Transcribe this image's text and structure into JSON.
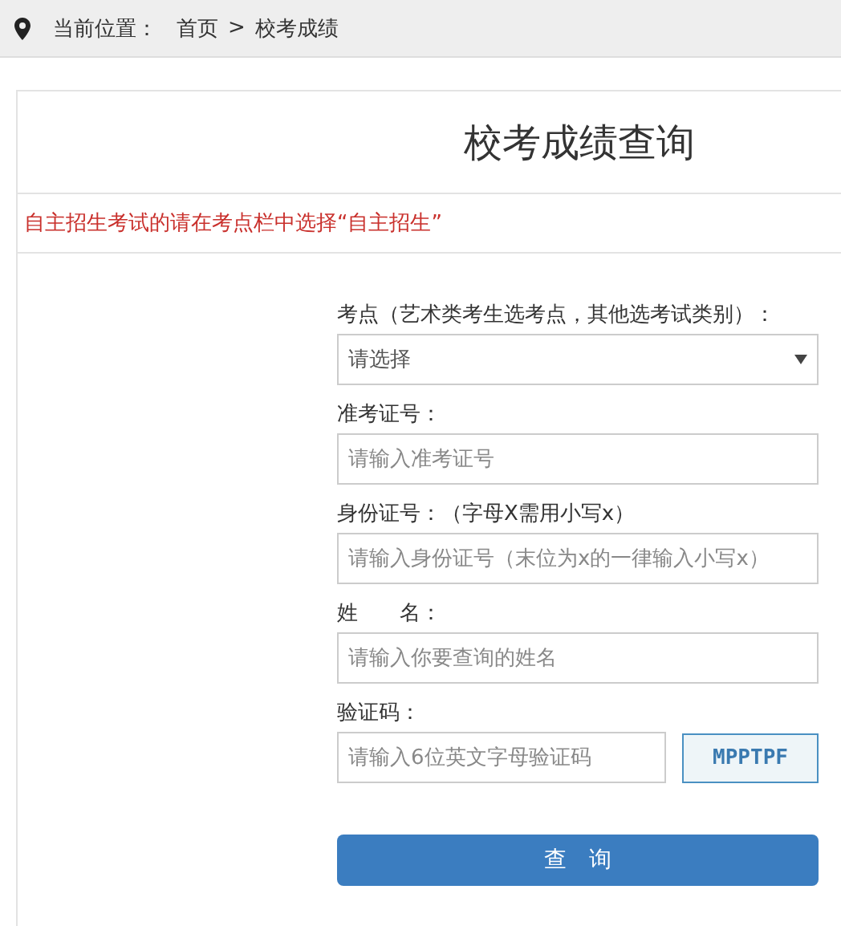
{
  "breadcrumb": {
    "label": "当前位置：",
    "items": [
      "首页",
      "校考成绩"
    ],
    "separator": ">"
  },
  "title": "校考成绩查询",
  "notice": "自主招生考试的请在考点栏中选择“自主招生”",
  "fields": [
    {
      "kind": "select",
      "label": "考点（艺术类考生选考点，其他选考试类别）：",
      "placeholder": "请选择"
    },
    {
      "kind": "input",
      "label": "准考证号：",
      "placeholder": "请输入准考证号"
    },
    {
      "kind": "input",
      "label": "身份证号：（字母X需用小写x）",
      "placeholder": "请输入身份证号（末位为x的一律输入小写x）"
    },
    {
      "kind": "input",
      "label": "姓　　名：",
      "placeholder": "请输入你要查询的姓名"
    },
    {
      "kind": "captcha",
      "label": "验证码：",
      "placeholder": "请输入6位英文字母验证码",
      "code": "MPPTPF"
    }
  ],
  "submit": "查　询"
}
